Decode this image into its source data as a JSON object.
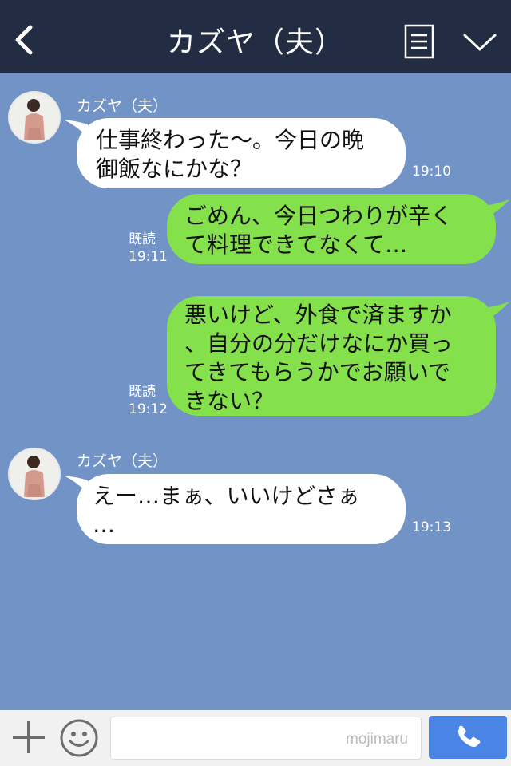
{
  "header": {
    "title": "カズヤ（夫）",
    "back_icon": "chevron-left-icon",
    "menu_icon": "list-icon",
    "collapse_icon": "chevron-down-icon"
  },
  "messages": [
    {
      "side": "in",
      "sender": "カズヤ（夫）",
      "text": "仕事終わった〜。今日の晩\n御飯なにかな？",
      "time": "19:10"
    },
    {
      "side": "out",
      "read_label": "既読",
      "text": "ごめん、今日つわりが辛く\nて料理できてなくて…",
      "time": "19:11"
    },
    {
      "side": "out",
      "read_label": "既読",
      "text": "悪いけど、外食で済ますか\n、自分の分だけなにか買っ\nてきてもらうかでお願いで\nきない？",
      "time": "19:12"
    },
    {
      "side": "in",
      "sender": "カズヤ（夫）",
      "text": "えー…まぁ、いいけどさぁ\n…",
      "time": "19:13"
    }
  ],
  "input_bar": {
    "plus_icon": "plus-icon",
    "emoji_icon": "smiley-icon",
    "input_value": "",
    "watermark": "mojimaru",
    "call_icon": "phone-icon"
  },
  "colors": {
    "header_bg": "#222c42",
    "chat_bg": "#7293c5",
    "incoming_bubble": "#ffffff",
    "outgoing_bubble": "#84e04b",
    "call_button": "#4a85e5"
  }
}
